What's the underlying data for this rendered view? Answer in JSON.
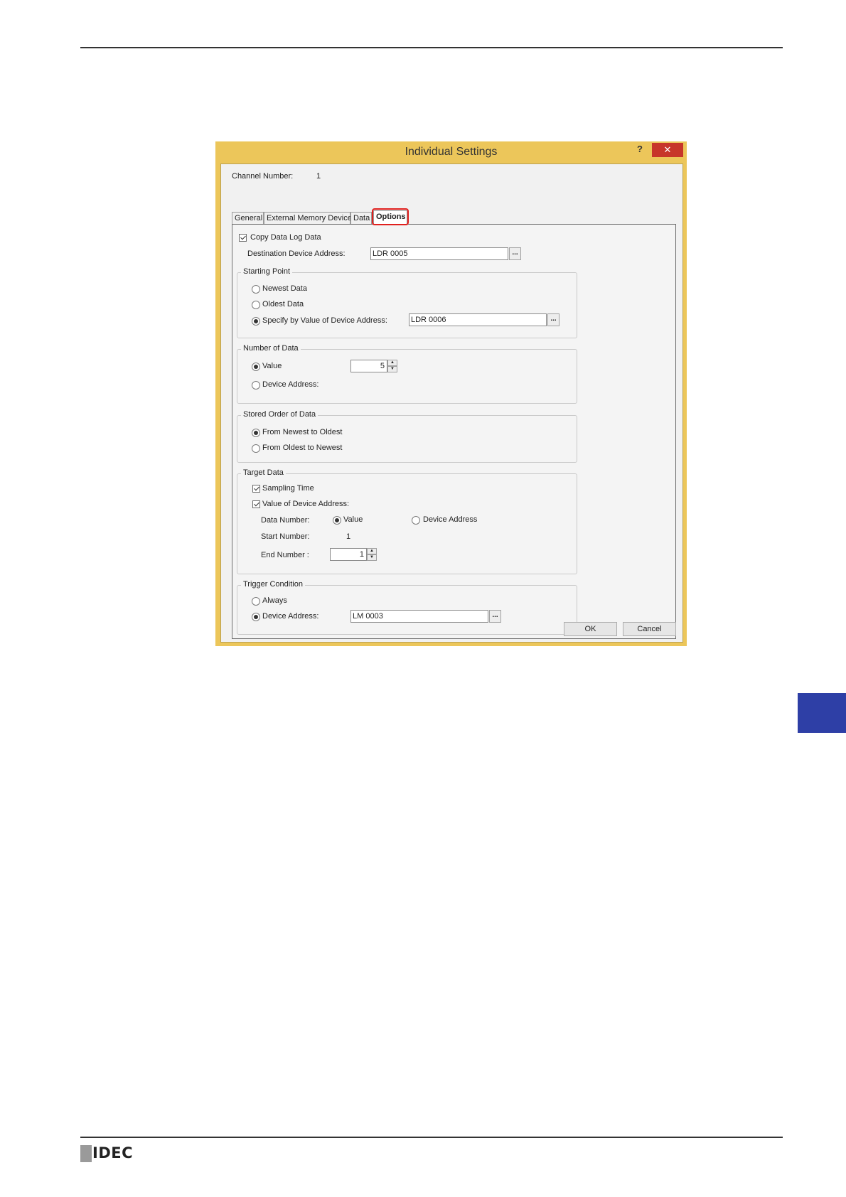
{
  "window": {
    "title": "Individual Settings",
    "help": "?",
    "close": "✕",
    "channel_label": "Channel Number:",
    "channel_value": "1"
  },
  "tabs": [
    "General",
    "External Memory Device",
    "Data",
    "Options"
  ],
  "copy": {
    "checkbox_label": "Copy Data Log Data",
    "checked": true,
    "dest_label": "Destination Device Address:",
    "dest_value": "LDR 0005"
  },
  "starting_point": {
    "title": "Starting Point",
    "opt_newest": "Newest Data",
    "opt_oldest": "Oldest Data",
    "opt_specify": "Specify by Value of Device Address:",
    "specify_value": "LDR 0006",
    "selected": "specify"
  },
  "number_of_data": {
    "title": "Number of Data",
    "opt_value": "Value",
    "opt_device": "Device Address:",
    "value": "5",
    "selected": "value"
  },
  "stored_order": {
    "title": "Stored Order of Data",
    "opt_newest_first": "From Newest to Oldest",
    "opt_oldest_first": "From Oldest to Newest",
    "selected": "newest_first"
  },
  "target_data": {
    "title": "Target Data",
    "sampling_time": "Sampling Time",
    "value_of_device": "Value of Device Address:",
    "data_number_label": "Data Number:",
    "opt_value": "Value",
    "opt_device": "Device Address",
    "start_label": "Start Number:",
    "start_value": "1",
    "end_label": "End Number :",
    "end_value": "1"
  },
  "trigger": {
    "title": "Trigger Condition",
    "opt_always": "Always",
    "opt_device": "Device Address:",
    "device_value": "LM 0003",
    "selected": "device"
  },
  "buttons": {
    "ok": "OK",
    "cancel": "Cancel",
    "browse": "..."
  },
  "footer": {
    "logo": "IDEC"
  },
  "colors": {
    "frame": "#ecc65a",
    "close": "#c7362a",
    "side_tab": "#2e3fa6",
    "highlight": "#e0201e"
  }
}
